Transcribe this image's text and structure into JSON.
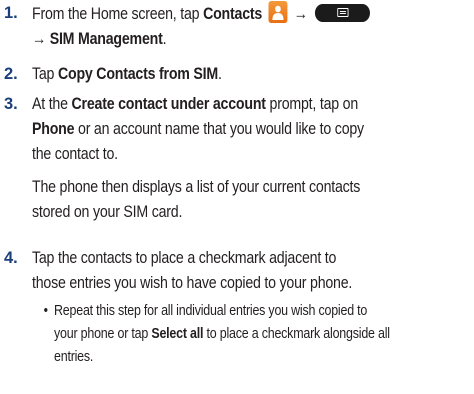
{
  "steps": [
    {
      "number": "1.",
      "line1_a": "From the Home screen, tap ",
      "line1_b": "Contacts",
      "arrow": "→",
      "line2": "→ SIM Management",
      "line2_end": "."
    },
    {
      "number": "2.",
      "pre": "Tap ",
      "bold": "Copy Contacts from SIM",
      "post": "."
    },
    {
      "number": "3.",
      "p1": "At the ",
      "p1_bold": "Create contact under account",
      "p1_post": " prompt, tap on",
      "p2_bold": "Phone",
      "p2_post": " or an account name that you would like to copy",
      "p3": "the contact to.",
      "p4": "The phone then displays a list of your current contacts",
      "p5": "stored on your SIM card."
    },
    {
      "number": "4.",
      "p1": "Tap the contacts to place a checkmark adjacent to",
      "p2": "those entries you wish to have copied to your phone."
    }
  ],
  "bullet": {
    "dot": "•",
    "l1": "Repeat this step for all individual entries you wish copied to",
    "l2_a": "your phone or tap ",
    "l2_bold": "Select all",
    "l2_b": " to place a checkmark alongside all",
    "l3": "entries."
  },
  "icons": {
    "contacts": "contacts-app-icon",
    "menu": "menu-key-icon"
  },
  "colors": {
    "step_number": "#1b3f7a",
    "text": "#231f20",
    "contacts_icon": "#ee7d1e"
  }
}
